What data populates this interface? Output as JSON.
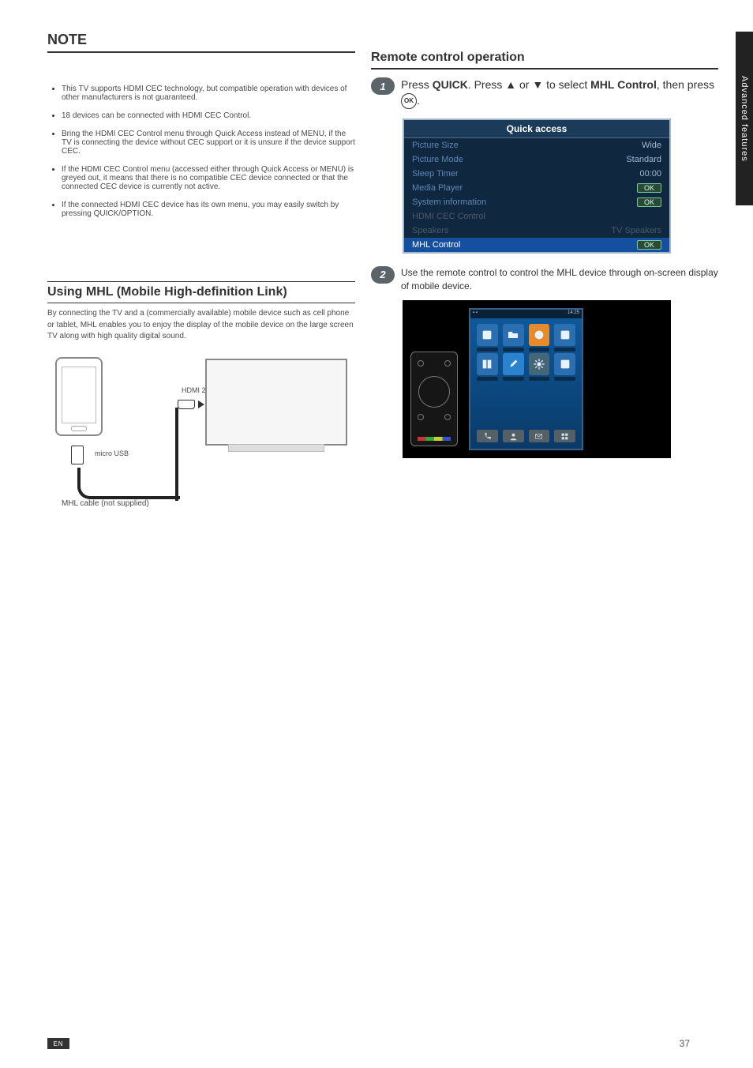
{
  "side_tab": "Advanced features",
  "page_number": "37",
  "lang_code": "EN",
  "left": {
    "note_heading": "NOTE",
    "bullets": [
      "This TV supports HDMI CEC technology, but compatible operation with devices of other manufacturers is not guaranteed.",
      "18 devices can be connected with HDMI CEC Control.",
      "Bring the HDMI CEC Control menu through Quick Access instead of MENU, if the TV is connecting the device without CEC support or it is unsure if the device support CEC.",
      "If the HDMI CEC Control menu (accessed either through Quick Access or MENU) is greyed out, it means that there is no compatible CEC device connected or that the connected CEC device is currently not active.",
      "If the connected HDMI CEC device has its own menu, you may easily switch by pressing QUICK/OPTION."
    ],
    "mhl_heading": "Using MHL (Mobile High-definition Link)",
    "mhl_desc": "By connecting the TV and a (commercially available) mobile device such as cell phone or tablet, MHL enables you to enjoy the display of the mobile device on the large screen TV along with high quality digital sound.",
    "diag": {
      "hdmi_label": "HDMI 2",
      "usb_label": "micro USB",
      "cable_label": "MHL cable (not supplied)"
    }
  },
  "right": {
    "proc_heading": "Remote control operation",
    "step1_pre": "Press ",
    "step1_quick": "QUICK",
    "step1_mid": ". Press ▲ or ▼ to select ",
    "step1_bold": "MHL Control",
    "step1_post": ", then press ",
    "quick_access": {
      "title": "Quick access",
      "rows": [
        {
          "label": "Picture Size",
          "value": "Wide",
          "type": "val"
        },
        {
          "label": "Picture Mode",
          "value": "Standard",
          "type": "val"
        },
        {
          "label": "Sleep Timer",
          "value": "00:00",
          "type": "val"
        },
        {
          "label": "Media Player",
          "value": "OK",
          "type": "ok"
        },
        {
          "label": "System information",
          "value": "OK",
          "type": "ok"
        },
        {
          "label": "HDMI CEC Control",
          "value": "",
          "type": "dim"
        },
        {
          "label": "Speakers",
          "value": "TV Speakers",
          "type": "dim"
        },
        {
          "label": "MHL Control",
          "value": "OK",
          "type": "hl"
        }
      ]
    },
    "step2_text": "Use the remote control to control the MHL device through on-screen display of mobile device.",
    "phone_time": "14:25"
  }
}
